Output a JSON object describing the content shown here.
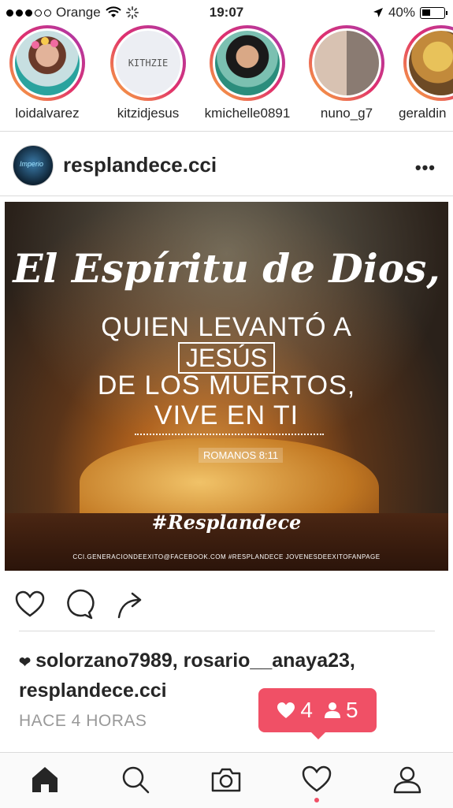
{
  "status_bar": {
    "carrier": "Orange",
    "time": "19:07",
    "battery_percent": "40%",
    "signal_bars_filled": 3,
    "signal_bars_total": 5,
    "battery_level": 0.4
  },
  "stories": [
    {
      "username": "loidalvarez"
    },
    {
      "username": "kitzidjesus",
      "pic_text": "KITHZIE"
    },
    {
      "username": "kmichelle0891"
    },
    {
      "username": "nuno_g7"
    },
    {
      "username": "geraldin"
    }
  ],
  "post": {
    "username": "resplandece.cci",
    "avatar_text": "Imperio",
    "more_label": "•••",
    "image_text": {
      "line1": "El Espíritu de Dios,",
      "line2": "QUIEN LEVANTÓ A",
      "line3": "JESÚS",
      "line4": "DE LOS MUERTOS,",
      "line5": "VIVE EN TI",
      "reference": "ROMANOS 8:11",
      "hashtag": "#Resplandece",
      "credits": "CCI.GENERACIONDEEXITO@FACEBOOK.COM   #RESPLANDECE   JOVENESDEEXITOFANPAGE"
    },
    "likes_text": "solorzano7989, rosario__anaya23, resplandece.cci",
    "time_ago": "HACE 4 HORAS"
  },
  "notification": {
    "likes_count": "4",
    "followers_count": "5"
  },
  "colors": {
    "accent": "#f05066",
    "text": "#262626",
    "muted": "#999999",
    "divider": "#dbdbdb"
  },
  "icons": {
    "like": "heart-outline-icon",
    "comment": "speech-bubble-icon",
    "share": "share-arrow-icon",
    "home": "home-icon",
    "search": "search-icon",
    "camera": "camera-icon",
    "activity": "heart-icon",
    "profile": "profile-icon"
  }
}
